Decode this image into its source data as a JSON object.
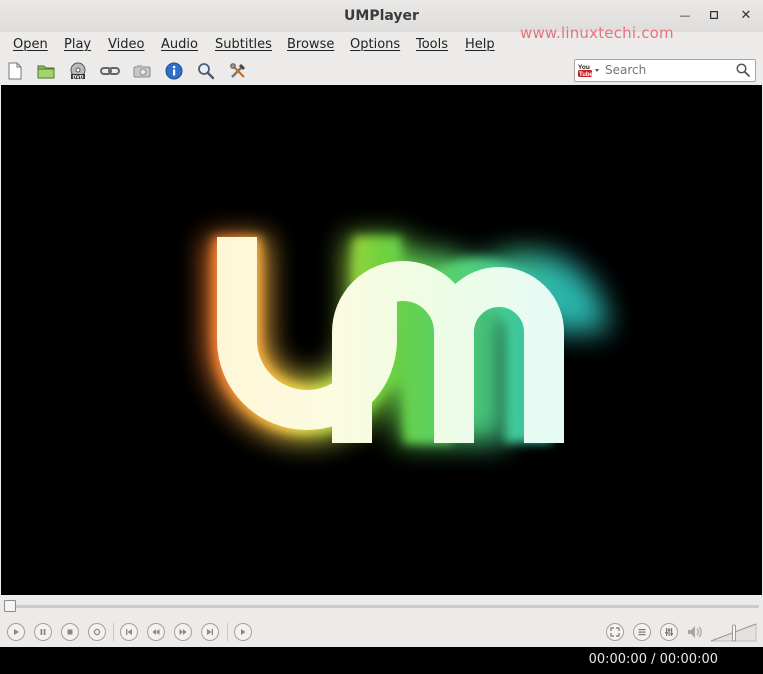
{
  "window": {
    "title": "UMPlayer"
  },
  "watermark": "www.linuxtechi.com",
  "menu": [
    "Open",
    "Play",
    "Video",
    "Audio",
    "Subtitles",
    "Browse",
    "Options",
    "Tools",
    "Help"
  ],
  "toolbar": {
    "icons": [
      "new-file-icon",
      "open-folder-icon",
      "dvd-icon",
      "link-icon",
      "screenshot-camera-icon",
      "info-icon",
      "find-subtitles-icon",
      "preferences-tools-icon"
    ],
    "search": {
      "placeholder": "Search",
      "provider_logo": "YouTube"
    }
  },
  "player": {
    "seek_position": 0,
    "time": "00:00:00 / 00:00:00",
    "volume_fraction": 0.5
  },
  "colors": {
    "accent_orange": "#e8823a",
    "accent_green": "#7bd84a",
    "accent_teal": "#37c7b2",
    "watermark": "#e5737e"
  }
}
